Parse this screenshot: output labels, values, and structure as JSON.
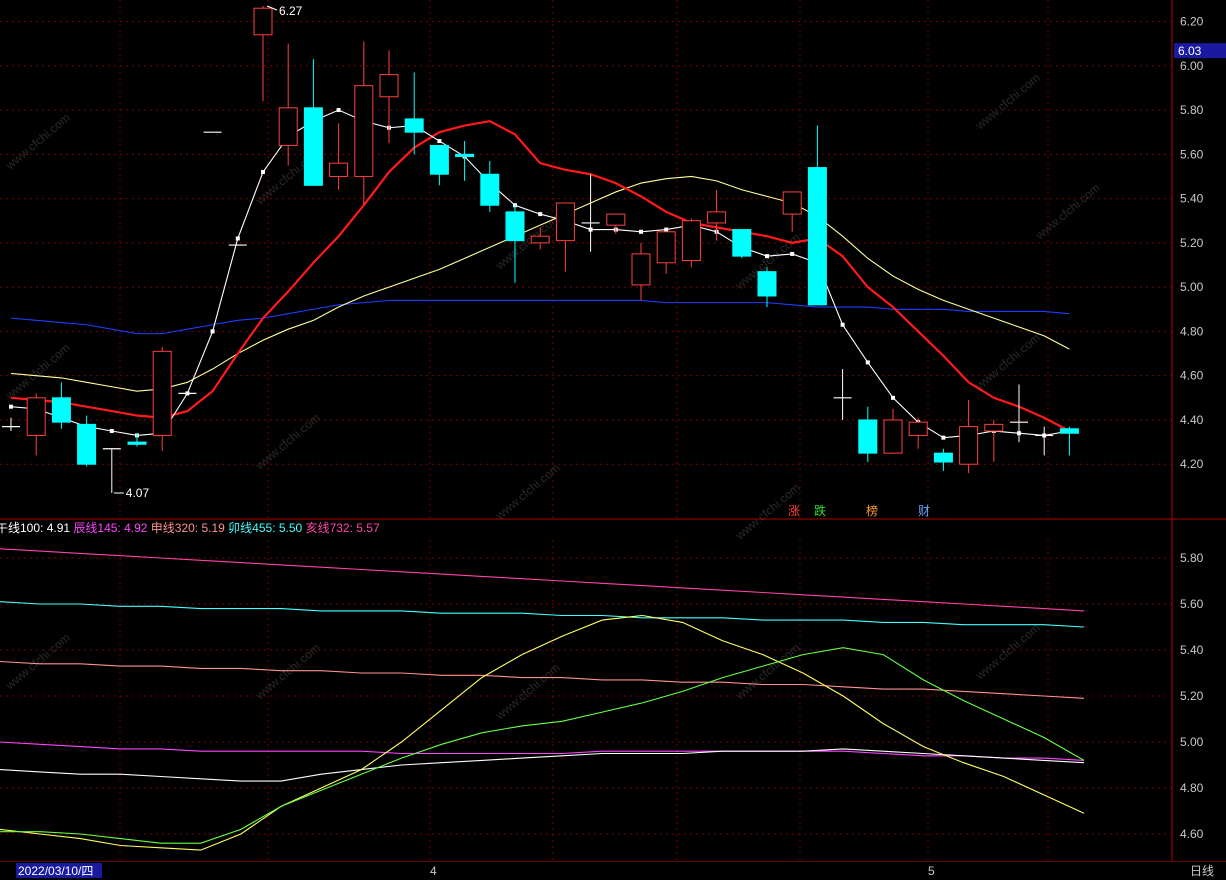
{
  "colors": {
    "bg": "#000000",
    "grid": "#7a0000",
    "frame": "#b00000",
    "up": "#ff4040",
    "down": "#00ffff",
    "ma5": "#ffffff",
    "ma10": "#ff1a1a",
    "ma20": "#ffff99",
    "ma60": "#1e3cff",
    "axis_text": "#c8c8c8",
    "watermark": "#2a2a2a"
  },
  "main_chart": {
    "ylim": [
      4.02,
      6.29
    ],
    "price_axis_ticks": [
      "6.20",
      "6.00",
      "5.80",
      "5.60",
      "5.40",
      "5.20",
      "5.00",
      "4.80",
      "4.60",
      "4.40",
      "4.20"
    ],
    "current_price": "6.03",
    "high_label": "6.27",
    "low_label": "4.07",
    "event_markers": [
      {
        "text": "涨",
        "color": "#ff4040"
      },
      {
        "text": "跌",
        "color": "#33dd33"
      },
      {
        "text": "榜",
        "color": "#ff9a30"
      },
      {
        "text": "财",
        "color": "#66aaff"
      }
    ]
  },
  "chart_data": {
    "type": "candlestick",
    "candles": [
      {
        "o": 4.37,
        "h": 4.41,
        "l": 4.35,
        "c": 4.37
      },
      {
        "o": 4.33,
        "h": 4.52,
        "l": 4.24,
        "c": 4.5
      },
      {
        "o": 4.5,
        "h": 4.57,
        "l": 4.36,
        "c": 4.39
      },
      {
        "o": 4.38,
        "h": 4.42,
        "l": 4.19,
        "c": 4.2
      },
      {
        "o": 4.27,
        "h": 4.27,
        "l": 4.07,
        "c": 4.27
      },
      {
        "o": 4.3,
        "h": 4.34,
        "l": 4.28,
        "c": 4.29
      },
      {
        "o": 4.33,
        "h": 4.73,
        "l": 4.26,
        "c": 4.71
      },
      {
        "o": 4.52,
        "h": 4.52,
        "l": 4.52,
        "c": 4.52
      },
      {
        "o": 5.7,
        "h": 5.7,
        "l": 5.7,
        "c": 5.7
      },
      {
        "o": 5.19,
        "h": 5.19,
        "l": 5.19,
        "c": 5.19
      },
      {
        "o": 6.14,
        "h": 6.27,
        "l": 5.84,
        "c": 6.26
      },
      {
        "o": 5.64,
        "h": 6.1,
        "l": 5.55,
        "c": 5.81
      },
      {
        "o": 5.81,
        "h": 6.03,
        "l": 5.46,
        "c": 5.46
      },
      {
        "o": 5.5,
        "h": 5.74,
        "l": 5.44,
        "c": 5.56
      },
      {
        "o": 5.5,
        "h": 6.11,
        "l": 5.37,
        "c": 5.91
      },
      {
        "o": 5.86,
        "h": 6.07,
        "l": 5.65,
        "c": 5.96
      },
      {
        "o": 5.76,
        "h": 5.97,
        "l": 5.6,
        "c": 5.7
      },
      {
        "o": 5.64,
        "h": 5.64,
        "l": 5.46,
        "c": 5.51
      },
      {
        "o": 5.6,
        "h": 5.66,
        "l": 5.48,
        "c": 5.59
      },
      {
        "o": 5.51,
        "h": 5.57,
        "l": 5.34,
        "c": 5.37
      },
      {
        "o": 5.34,
        "h": 5.37,
        "l": 5.02,
        "c": 5.21
      },
      {
        "o": 5.2,
        "h": 5.27,
        "l": 5.17,
        "c": 5.23
      },
      {
        "o": 5.21,
        "h": 5.38,
        "l": 5.07,
        "c": 5.38
      },
      {
        "o": 5.29,
        "h": 5.51,
        "l": 5.16,
        "c": 5.29
      },
      {
        "o": 5.28,
        "h": 5.33,
        "l": 5.24,
        "c": 5.33
      },
      {
        "o": 5.01,
        "h": 5.2,
        "l": 4.94,
        "c": 5.15
      },
      {
        "o": 5.11,
        "h": 5.25,
        "l": 5.06,
        "c": 5.25
      },
      {
        "o": 5.12,
        "h": 5.31,
        "l": 5.09,
        "c": 5.3
      },
      {
        "o": 5.29,
        "h": 5.44,
        "l": 5.21,
        "c": 5.34
      },
      {
        "o": 5.26,
        "h": 5.26,
        "l": 5.13,
        "c": 5.14
      },
      {
        "o": 5.07,
        "h": 5.09,
        "l": 4.91,
        "c": 4.96
      },
      {
        "o": 5.33,
        "h": 5.43,
        "l": 5.25,
        "c": 5.43
      },
      {
        "o": 5.54,
        "h": 5.73,
        "l": 4.92,
        "c": 4.92
      },
      {
        "o": 4.5,
        "h": 4.63,
        "l": 4.4,
        "c": 4.5
      },
      {
        "o": 4.4,
        "h": 4.46,
        "l": 4.21,
        "c": 4.25
      },
      {
        "o": 4.25,
        "h": 4.45,
        "l": 4.25,
        "c": 4.4
      },
      {
        "o": 4.33,
        "h": 4.41,
        "l": 4.27,
        "c": 4.39
      },
      {
        "o": 4.25,
        "h": 4.27,
        "l": 4.17,
        "c": 4.21
      },
      {
        "o": 4.2,
        "h": 4.49,
        "l": 4.16,
        "c": 4.37
      },
      {
        "o": 4.35,
        "h": 4.4,
        "l": 4.21,
        "c": 4.38
      },
      {
        "o": 4.39,
        "h": 4.56,
        "l": 4.3,
        "c": 4.39
      },
      {
        "o": 4.33,
        "h": 4.37,
        "l": 4.24,
        "c": 4.33
      },
      {
        "o": 4.36,
        "h": 4.37,
        "l": 4.24,
        "c": 4.34
      }
    ],
    "ma_lines": [
      {
        "name": "MA5",
        "color": "#ffffff",
        "values": [
          4.46,
          4.45,
          4.41,
          4.37,
          4.35,
          4.33,
          4.34,
          4.52,
          4.8,
          5.22,
          5.52,
          5.68,
          5.75,
          5.8,
          5.75,
          5.72,
          5.73,
          5.66,
          5.59,
          5.47,
          5.37,
          5.33,
          5.3,
          5.26,
          5.26,
          5.25,
          5.26,
          5.28,
          5.25,
          5.18,
          5.14,
          5.15,
          5.11,
          4.83,
          4.66,
          4.5,
          4.39,
          4.32,
          4.33,
          4.35,
          4.34,
          4.33,
          4.35
        ],
        "dots": true
      },
      {
        "name": "MA10",
        "color": "#ff1a1a",
        "values": [
          4.5,
          4.49,
          4.48,
          4.46,
          4.44,
          4.42,
          4.41,
          4.44,
          4.53,
          4.7,
          4.86,
          4.98,
          5.11,
          5.23,
          5.37,
          5.52,
          5.63,
          5.7,
          5.73,
          5.75,
          5.69,
          5.56,
          5.53,
          5.51,
          5.47,
          5.41,
          5.34,
          5.29,
          5.27,
          5.25,
          5.23,
          5.2,
          5.22,
          5.14,
          5.0,
          4.91,
          4.8,
          4.69,
          4.57,
          4.5,
          4.46,
          4.41,
          4.35
        ],
        "dots": false
      },
      {
        "name": "MA20",
        "color": "#ffff99",
        "values": [
          4.61,
          4.6,
          4.59,
          4.57,
          4.55,
          4.53,
          4.54,
          4.57,
          4.63,
          4.7,
          4.76,
          4.81,
          4.85,
          4.91,
          4.96,
          5.0,
          5.04,
          5.08,
          5.13,
          5.18,
          5.23,
          5.28,
          5.33,
          5.38,
          5.43,
          5.47,
          5.49,
          5.5,
          5.48,
          5.44,
          5.41,
          5.38,
          5.32,
          5.23,
          5.13,
          5.05,
          4.99,
          4.94,
          4.9,
          4.86,
          4.82,
          4.78,
          4.72
        ],
        "dots": false
      },
      {
        "name": "MA60",
        "color": "#1e3cff",
        "values": [
          4.86,
          4.85,
          4.84,
          4.83,
          4.81,
          4.79,
          4.79,
          4.81,
          4.83,
          4.85,
          4.86,
          4.88,
          4.9,
          4.92,
          4.93,
          4.94,
          4.94,
          4.94,
          4.94,
          4.94,
          4.94,
          4.94,
          4.94,
          4.94,
          4.94,
          4.94,
          4.93,
          4.93,
          4.93,
          4.93,
          4.93,
          4.92,
          4.91,
          4.91,
          4.91,
          4.9,
          4.9,
          4.9,
          4.89,
          4.89,
          4.89,
          4.89,
          4.88
        ],
        "dots": false
      }
    ]
  },
  "sub_chart": {
    "legend": [
      {
        "name": "午线100",
        "value": "4.91",
        "color": "#ffffff"
      },
      {
        "name": "辰线145",
        "value": "4.92",
        "color": "#ff44ff"
      },
      {
        "name": "申线320",
        "value": "5.19",
        "color": "#ff9090"
      },
      {
        "name": "卯线455",
        "value": "5.50",
        "color": "#44ffff"
      },
      {
        "name": "亥线732",
        "value": "5.57",
        "color": "#ff44aa"
      }
    ],
    "ylim": [
      4.48,
      5.98
    ],
    "axis_ticks": [
      "5.80",
      "5.60",
      "5.40",
      "5.20",
      "5.00",
      "4.80",
      "4.60"
    ],
    "series": [
      {
        "name": "亥线732",
        "color": "#ff44aa",
        "values": [
          5.84,
          5.83,
          5.82,
          5.81,
          5.8,
          5.79,
          5.78,
          5.77,
          5.76,
          5.75,
          5.74,
          5.73,
          5.72,
          5.71,
          5.7,
          5.69,
          5.68,
          5.67,
          5.66,
          5.65,
          5.64,
          5.63,
          5.62,
          5.61,
          5.6,
          5.59,
          5.58,
          5.57
        ]
      },
      {
        "name": "卯线455",
        "color": "#44ffff",
        "values": [
          5.61,
          5.6,
          5.6,
          5.59,
          5.59,
          5.58,
          5.58,
          5.58,
          5.57,
          5.57,
          5.57,
          5.56,
          5.56,
          5.56,
          5.55,
          5.55,
          5.54,
          5.54,
          5.54,
          5.53,
          5.53,
          5.53,
          5.52,
          5.52,
          5.51,
          5.51,
          5.51,
          5.5
        ]
      },
      {
        "name": "申线320",
        "color": "#ff9090",
        "values": [
          5.35,
          5.34,
          5.34,
          5.33,
          5.33,
          5.32,
          5.32,
          5.31,
          5.31,
          5.3,
          5.3,
          5.29,
          5.29,
          5.28,
          5.28,
          5.27,
          5.27,
          5.26,
          5.26,
          5.25,
          5.25,
          5.24,
          5.23,
          5.23,
          5.22,
          5.21,
          5.2,
          5.19
        ]
      },
      {
        "name": "辰线145",
        "color": "#ff44ff",
        "values": [
          5.0,
          4.99,
          4.98,
          4.97,
          4.97,
          4.96,
          4.96,
          4.96,
          4.96,
          4.96,
          4.95,
          4.95,
          4.95,
          4.95,
          4.95,
          4.96,
          4.96,
          4.96,
          4.96,
          4.96,
          4.96,
          4.96,
          4.95,
          4.94,
          4.94,
          4.93,
          4.93,
          4.92
        ]
      },
      {
        "name": "午线100",
        "color": "#ffffff",
        "values": [
          4.88,
          4.87,
          4.86,
          4.86,
          4.85,
          4.84,
          4.83,
          4.83,
          4.86,
          4.88,
          4.9,
          4.91,
          4.92,
          4.93,
          4.94,
          4.95,
          4.95,
          4.95,
          4.96,
          4.96,
          4.96,
          4.97,
          4.96,
          4.95,
          4.94,
          4.93,
          4.92,
          4.91
        ]
      },
      {
        "name": "Yellow",
        "color": "#ffff66",
        "values": [
          4.62,
          4.6,
          4.58,
          4.55,
          4.54,
          4.53,
          4.6,
          4.72,
          4.8,
          4.88,
          5.0,
          5.14,
          5.28,
          5.38,
          5.46,
          5.53,
          5.55,
          5.52,
          5.44,
          5.38,
          5.3,
          5.2,
          5.08,
          4.98,
          4.91,
          4.85,
          4.77,
          4.69
        ]
      },
      {
        "name": "Green",
        "color": "#66ff44",
        "values": [
          4.61,
          4.61,
          4.6,
          4.58,
          4.56,
          4.56,
          4.62,
          4.72,
          4.79,
          4.86,
          4.93,
          4.99,
          5.04,
          5.07,
          5.09,
          5.13,
          5.17,
          5.22,
          5.28,
          5.33,
          5.38,
          5.41,
          5.38,
          5.27,
          5.18,
          5.1,
          5.02,
          4.92
        ]
      }
    ]
  },
  "bottom_bar": {
    "date": "2022/03/10/四",
    "month_4": "4",
    "month_5": "5",
    "period": "日线"
  },
  "watermark": "www.cfchi.com"
}
